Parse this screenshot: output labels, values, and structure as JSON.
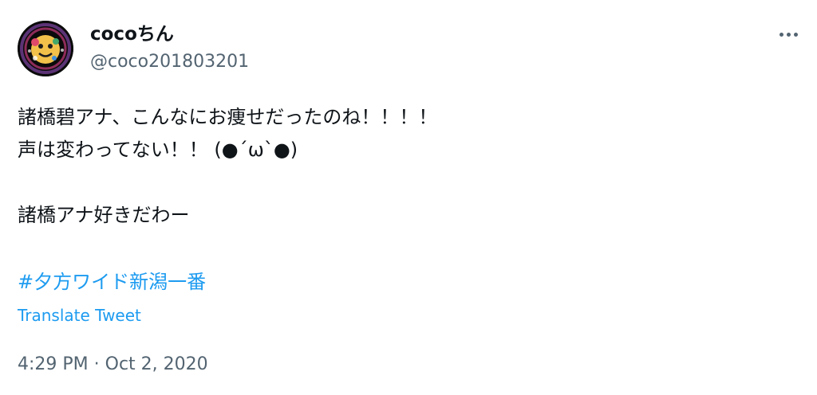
{
  "user": {
    "display_name": "cocoちん",
    "handle": "@coco201803201",
    "avatar_icon": "avatar-image"
  },
  "tweet": {
    "text_lines": [
      "諸橋碧アナ、こんなにお痩せだったのね！！！！",
      "声は変わってない！！ (●´ω`●)",
      "",
      "諸橋アナ好きだわー"
    ],
    "hashtag": "#夕方ワイド新潟一番",
    "translate_label": "Translate Tweet",
    "time": "4:29 PM",
    "separator": " · ",
    "date": "Oct 2, 2020"
  },
  "icons": {
    "more": "more-horizontal-icon"
  },
  "colors": {
    "text": "#0f1419",
    "secondary": "#536471",
    "link": "#1d9bf0",
    "background": "#ffffff"
  }
}
